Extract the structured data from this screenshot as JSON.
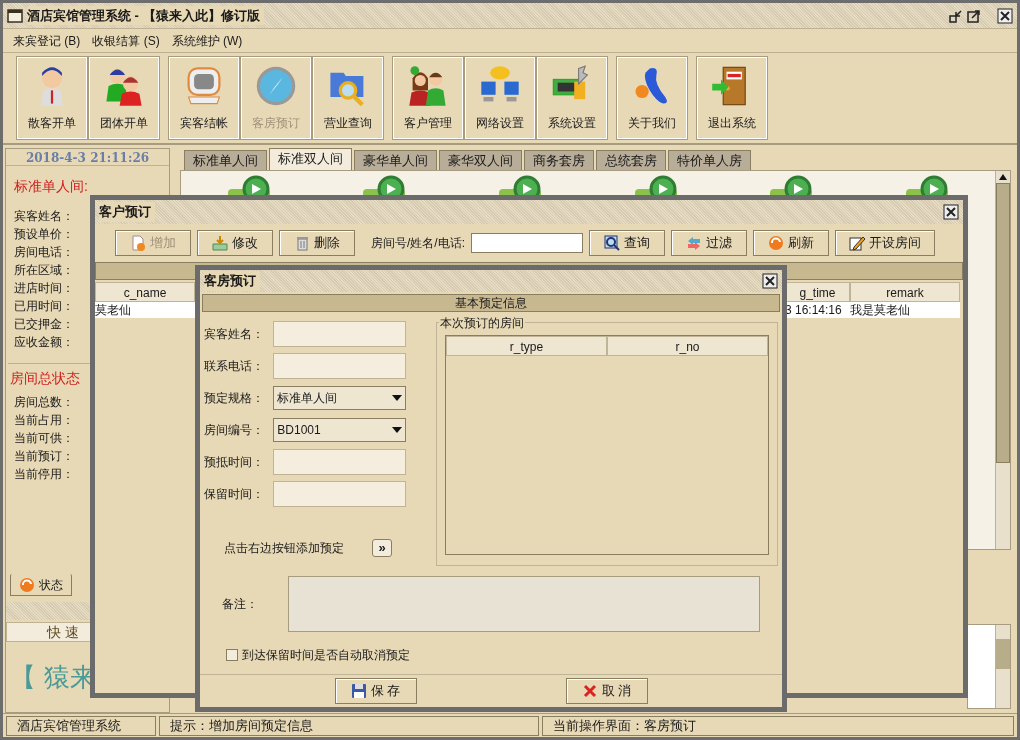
{
  "window": {
    "title": "酒店宾馆管理系统 - 【猿来入此】修订版"
  },
  "menu": [
    {
      "label": "来宾登记 (B)"
    },
    {
      "label": "收银结算 (S)"
    },
    {
      "label": "系统维护 (W)"
    }
  ],
  "toolbar_groups": [
    {
      "buttons": [
        {
          "label": "散客开单",
          "disabled": false
        },
        {
          "label": "团体开单",
          "disabled": false
        }
      ]
    },
    {
      "buttons": [
        {
          "label": "宾客结帐",
          "disabled": false
        },
        {
          "label": "客房预订",
          "disabled": true
        },
        {
          "label": "营业查询",
          "disabled": false
        }
      ]
    },
    {
      "buttons": [
        {
          "label": "客户管理",
          "disabled": false
        },
        {
          "label": "网络设置",
          "disabled": false
        },
        {
          "label": "系统设置",
          "disabled": false
        }
      ]
    },
    {
      "buttons": [
        {
          "label": "关于我们",
          "disabled": false
        }
      ]
    },
    {
      "buttons": [
        {
          "label": "退出系统",
          "disabled": false
        }
      ]
    }
  ],
  "left_panel": {
    "datetime": "2018-4-3  21:11:26",
    "room_heading": "标准单人间:",
    "room_fields": [
      "宾客姓名：",
      "预设单价：",
      "房间电话：",
      "所在区域：",
      "进店时间：",
      "已用时间：",
      "已交押金：",
      "应收金额："
    ],
    "status_heading": "房间总状态",
    "status_fields": [
      "房间总数：",
      "当前占用：",
      "当前可供：",
      "当前预订：",
      "当前停用："
    ],
    "tabs": [
      {
        "label": "状态",
        "selected": true
      }
    ],
    "quick_label": "快 速",
    "banner": "【 猿来"
  },
  "room_tabs": [
    {
      "label": "标准单人间",
      "selected": false
    },
    {
      "label": "标准双人间",
      "selected": true
    },
    {
      "label": "豪华单人间",
      "selected": false
    },
    {
      "label": "豪华双人间",
      "selected": false
    },
    {
      "label": "商务套房",
      "selected": false
    },
    {
      "label": "总统套房",
      "selected": false
    },
    {
      "label": "特价单人房",
      "selected": false
    }
  ],
  "customer_dialog": {
    "title": "客户预订",
    "buttons": [
      {
        "label": "增加",
        "disabled": true
      },
      {
        "label": "修改",
        "disabled": false
      },
      {
        "label": "删除",
        "disabled": false
      }
    ],
    "search_label": "房间号/姓名/电话:",
    "search_buttons": [
      {
        "label": "查询"
      },
      {
        "label": "过滤"
      },
      {
        "label": "刷新"
      },
      {
        "label": "开设房间"
      }
    ],
    "table": {
      "columns": [
        "c_name",
        "g_time",
        "remark"
      ],
      "rows": [
        [
          "莫老仙",
          "3 16:14:16",
          "我是莫老仙"
        ]
      ]
    }
  },
  "booking_dialog": {
    "title": "客房预订",
    "section": "基本预定信息",
    "fields": [
      {
        "label": "宾客姓名：",
        "kind": "text"
      },
      {
        "label": "联系电话：",
        "kind": "text"
      },
      {
        "label": "预定规格：",
        "kind": "select",
        "value": "标准单人间"
      },
      {
        "label": "房间编号：",
        "kind": "select",
        "value": "BD1001"
      },
      {
        "label": "预抵时间：",
        "kind": "text"
      },
      {
        "label": "保留时间：",
        "kind": "text"
      }
    ],
    "rooms_group": {
      "title": "本次预订的房间",
      "columns": [
        "r_type",
        "r_no"
      ]
    },
    "add_hint": "点击右边按钮添加预定",
    "add_button": "»",
    "remark_label": "备注：",
    "auto_cancel": {
      "label": "到达保留时间是否自动取消预定",
      "checked": false
    },
    "buttons": [
      {
        "label": "保 存"
      },
      {
        "label": "取 消"
      }
    ]
  },
  "status_bar": [
    "酒店宾馆管理系统",
    "提示：增加房间预定信息",
    "当前操作界面：客房预订"
  ]
}
